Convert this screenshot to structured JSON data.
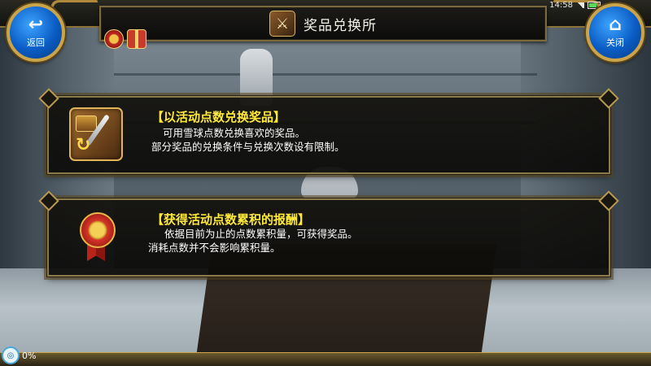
{
  "title": "奖品兑换所",
  "status": {
    "time": "14:58"
  },
  "nav": {
    "back_label": "返回",
    "close_label": "关闭"
  },
  "panels": [
    {
      "heading": "【以活动点数兑换奖品】",
      "lines": [
        "可用雪球点数兑换喜欢的奖品。",
        "部分奖品的兑换条件与兑换次数设有限制。"
      ],
      "icon": "exchange-reward-icon"
    },
    {
      "heading": "【获得活动点数累积的报酬】",
      "lines": [
        "依据目前为止的点数累积量，可获得奖品。",
        "消耗点数并不会影响累积量。"
      ],
      "icon": "medal-icon"
    }
  ],
  "loading": {
    "percent": "0%"
  },
  "colors": {
    "heading": "#ffe93a",
    "button_blue": "#0a5cc4",
    "frame_gold": "#c9a44a"
  }
}
